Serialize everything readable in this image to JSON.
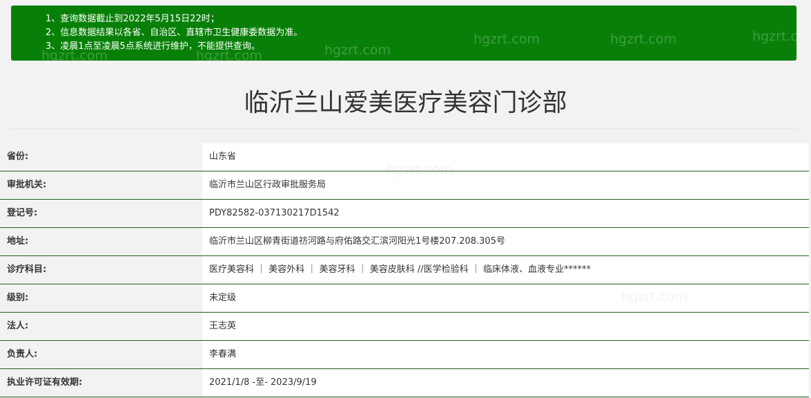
{
  "notice": {
    "lines": [
      "1、查询数据截止到2022年5月15日22时；",
      "2、信息数据结果以各省、自治区、直辖市卫生健康委数据为准。",
      "3、凌晨1点至凌晨5点系统进行维护，不能提供查询。"
    ],
    "watermark": "hgzrt.com"
  },
  "title": "临沂兰山爱美医疗美容门诊部",
  "fields": [
    {
      "label": "省份:",
      "value": "山东省"
    },
    {
      "label": "审批机关:",
      "value": "临沂市兰山区行政审批服务局"
    },
    {
      "label": "登记号:",
      "value": "PDY82582-037130217D1542"
    },
    {
      "label": "地址:",
      "value": "临沂市兰山区柳青街道祊河路与府佑路交汇滨河阳光1号楼207.208.305号"
    },
    {
      "label": "诊疗科目:",
      "value": "医疗美容科 ｜ 美容外科 ｜ 美容牙科 ｜ 美容皮肤科 //医学检验科 ｜ 临床体液、血液专业******"
    },
    {
      "label": "级别:",
      "value": "未定级"
    },
    {
      "label": "法人:",
      "value": "王志英"
    },
    {
      "label": "负责人:",
      "value": "李春满"
    },
    {
      "label": "执业许可证有效期:",
      "value": "2021/1/8 -至- 2023/9/19"
    }
  ],
  "colors": {
    "notice_bg": "#088008",
    "row_border": "#1e5e1e",
    "page_bg": "#f2f2f2"
  }
}
